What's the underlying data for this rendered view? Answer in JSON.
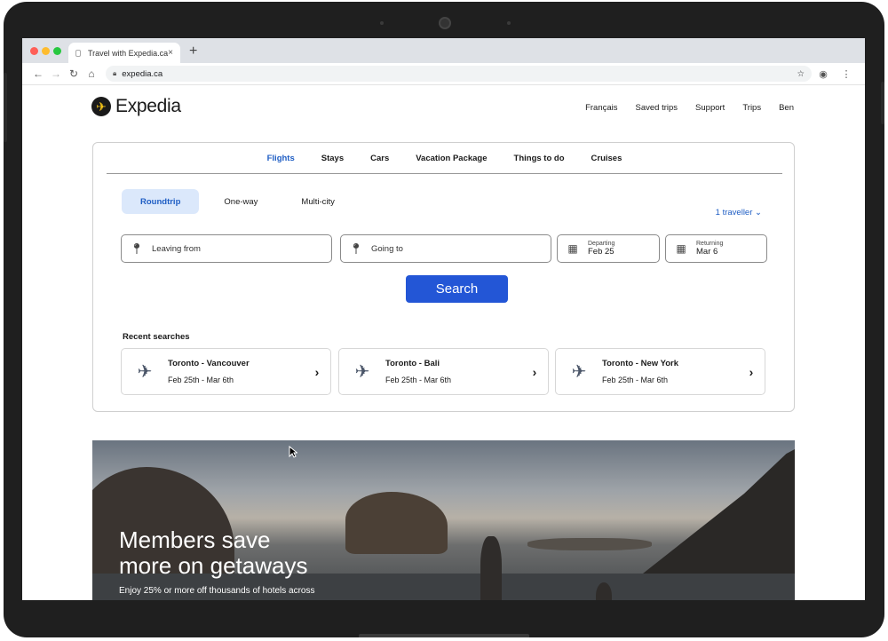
{
  "browser": {
    "tab_title": "Travel with Expedia.ca",
    "tab_close": "×",
    "new_tab": "+",
    "url": "expedia.ca"
  },
  "header": {
    "brand": "Expedia",
    "nav": [
      "Français",
      "Saved trips",
      "Support",
      "Trips",
      "Ben"
    ]
  },
  "search": {
    "tabs": [
      "Flights",
      "Stays",
      "Cars",
      "Vacation Package",
      "Things to do",
      "Cruises"
    ],
    "active_tab": "Flights",
    "trip_types": [
      "Roundtrip",
      "One-way",
      "Multi-city"
    ],
    "traveller": "1 traveller",
    "leaving_placeholder": "Leaving from",
    "going_placeholder": "Going to",
    "departing_label": "Departing",
    "departing_value": "Feb 25",
    "returning_label": "Returning",
    "returning_value": "Mar 6",
    "button": "Search"
  },
  "recent": {
    "title": "Recent searches",
    "items": [
      {
        "route": "Toronto - Vancouver",
        "dates": "Feb 25th - Mar 6th"
      },
      {
        "route": "Toronto - Bali",
        "dates": "Feb 25th - Mar 6th"
      },
      {
        "route": "Toronto - New York",
        "dates": "Feb 25th - Mar 6th"
      }
    ]
  },
  "hero": {
    "title_line1": "Members save",
    "title_line2": "more on getaways",
    "subtitle": "Enjoy 25% or more off thousands of hotels across"
  },
  "colors": {
    "accent": "#1f5ec4",
    "button": "#2356d6",
    "active_pill": "#dbe8fb"
  }
}
